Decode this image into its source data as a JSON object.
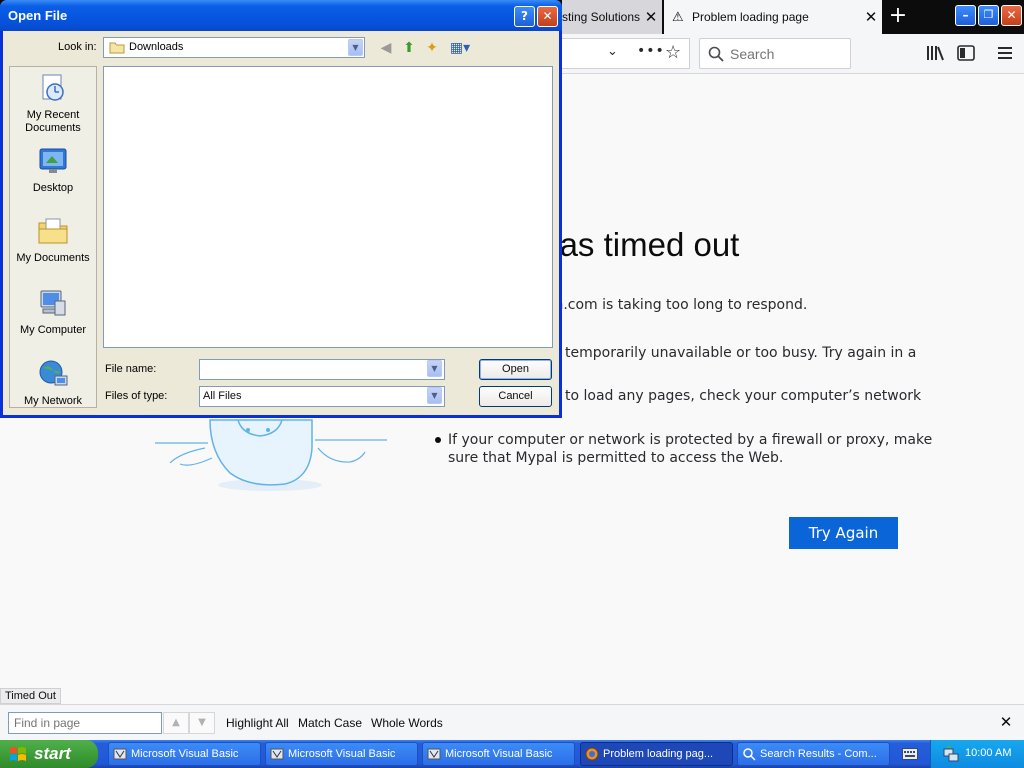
{
  "browser": {
    "tabs": [
      {
        "title": "Hosting Solutions",
        "active": false
      },
      {
        "title": "Problem loading page",
        "active": true
      }
    ],
    "search_placeholder": "Search",
    "error": {
      "title": "The connection has timed out",
      "intro": "The server at www.dragon.com is taking too long to respond.",
      "bullets": [
        "The site could be temporarily unavailable or too busy. Try again in a few moments.",
        "If you are unable to load any pages, check your computer’s network connection.",
        "If your computer or network is protected by a firewall or proxy, make sure that Mypal is permitted to access the Web."
      ],
      "visible_title": "ection has timed out",
      "visible_intro": "gon.com is taking too long to respond.",
      "visible_b1": "temporarily unavailable or too busy. Try again in a",
      "visible_b2": "to load any pages, check your computer’s network",
      "visible_b3_line1": "If your computer or network is protected by a firewall or proxy, make",
      "visible_b3_line2": "sure that Mypal is permitted to access the Web.",
      "try_again": "Try Again"
    },
    "status_text": "Timed Out",
    "findbar": {
      "placeholder": "Find in page",
      "highlight_all": "Highlight All",
      "match_case": "Match Case",
      "whole_words": "Whole Words"
    }
  },
  "dialog": {
    "title": "Open File",
    "look_in_label": "Look in:",
    "look_in_value": "Downloads",
    "places": [
      "My Recent Documents",
      "Desktop",
      "My Documents",
      "My Computer",
      "My Network"
    ],
    "file_name_label": "File name:",
    "file_name_value": "",
    "files_of_type_label": "Files of type:",
    "files_of_type_value": "All Files",
    "open_button": "Open",
    "cancel_button": "Cancel"
  },
  "taskbar": {
    "start": "start",
    "tasks": [
      {
        "label": "Microsoft Visual Basic",
        "active": false
      },
      {
        "label": "Microsoft Visual Basic",
        "active": false
      },
      {
        "label": "Microsoft Visual Basic",
        "active": false
      },
      {
        "label": "Problem loading pag...",
        "active": true
      },
      {
        "label": "Search Results - Com...",
        "active": false
      }
    ],
    "clock": "10:00 AM"
  },
  "colors": {
    "xp_blue": "#0a5ee8",
    "button_blue": "#0a66d8",
    "start_green": "#3c9a36",
    "dialog_face": "#ece9d8"
  }
}
